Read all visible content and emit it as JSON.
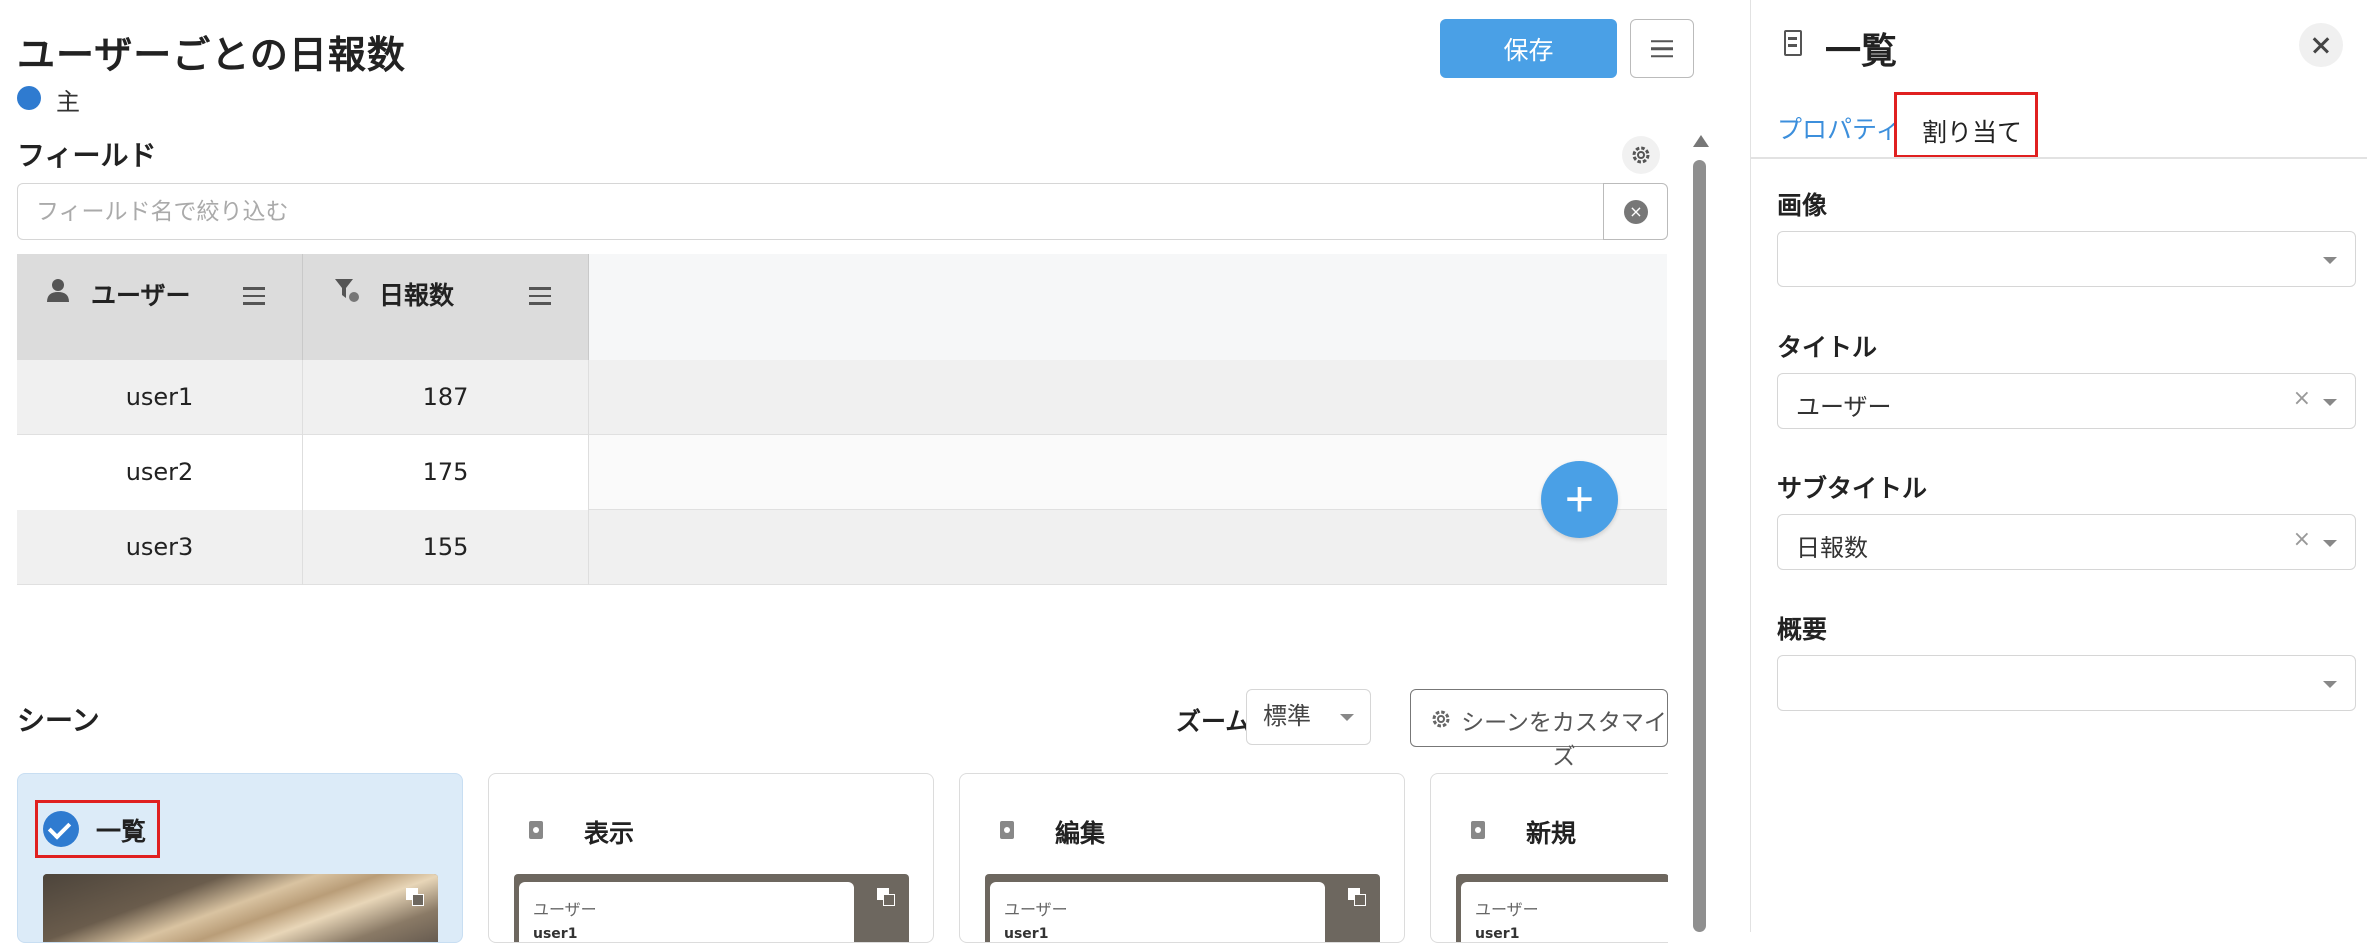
{
  "header": {
    "title": "ユーザーごとの日報数",
    "source_label": "主",
    "save_label": "保存"
  },
  "fields": {
    "heading": "フィールド",
    "filter_placeholder": "フィールド名で絞り込む",
    "clear_icon": "×",
    "columns": [
      {
        "label": "ユーザー",
        "icon": "user-icon"
      },
      {
        "label": "日報数",
        "icon": "filter-function-icon"
      }
    ],
    "rows": [
      {
        "user": "user1",
        "count": "187"
      },
      {
        "user": "user2",
        "count": "175"
      },
      {
        "user": "user3",
        "count": "155"
      }
    ],
    "add_label": "+"
  },
  "scenes": {
    "heading": "シーン",
    "zoom_label": "ズーム",
    "zoom_value": "標準",
    "customize_label": "シーンをカスタマイズ",
    "items": [
      {
        "label": "一覧",
        "selected": true,
        "thumb_user": "",
        "thumb_value": ""
      },
      {
        "label": "表示",
        "selected": false,
        "thumb_user": "ユーザー",
        "thumb_value": "user1"
      },
      {
        "label": "編集",
        "selected": false,
        "thumb_user": "ユーザー",
        "thumb_value": "user1"
      },
      {
        "label": "新規",
        "selected": false,
        "thumb_user": "ユーザー",
        "thumb_value": "user1"
      }
    ]
  },
  "panel": {
    "title": "一覧",
    "tabs": {
      "properties": "プロパティ",
      "assign": "割り当て"
    },
    "fields": [
      {
        "label": "画像",
        "value": "",
        "clearable": false
      },
      {
        "label": "タイトル",
        "value": "ユーザー",
        "clearable": true
      },
      {
        "label": "サブタイトル",
        "value": "日報数",
        "clearable": true
      },
      {
        "label": "概要",
        "value": "",
        "clearable": false
      }
    ],
    "clear_glyph": "×"
  },
  "colors": {
    "accent": "#4aa0e6",
    "selected_scene_bg": "#dcebf8",
    "highlight_border": "#e02020",
    "source_dot": "#2f7bd0"
  }
}
